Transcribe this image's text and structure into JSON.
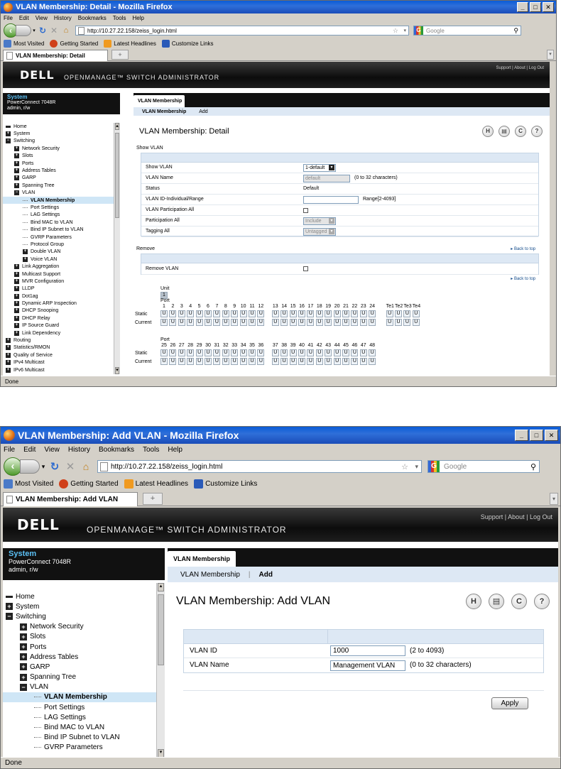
{
  "w1": {
    "title": "VLAN Membership: Detail - Mozilla Firefox",
    "menu": [
      "File",
      "Edit",
      "View",
      "History",
      "Bookmarks",
      "Tools",
      "Help"
    ],
    "url": "http://10.27.22.158/zeiss_login.html",
    "search_placeholder": "Google",
    "bookmarks": [
      "Most Visited",
      "Getting Started",
      "Latest Headlines",
      "Customize Links"
    ],
    "tab": "VLAN Membership: Detail",
    "brand": "DELL",
    "product": "OPENMANAGE™ SWITCH ADMINISTRATOR",
    "toplinks": "Support | About | Log Out",
    "system": {
      "title": "System",
      "model": "PowerConnect 7048R",
      "user": "admin, r/w"
    },
    "tree": [
      {
        "label": "Home",
        "lvl": 0,
        "exp": "dash"
      },
      {
        "label": "System",
        "lvl": 0,
        "exp": "plus"
      },
      {
        "label": "Switching",
        "lvl": 0,
        "exp": "minus"
      },
      {
        "label": "Network Security",
        "lvl": 1,
        "exp": "plus"
      },
      {
        "label": "Slots",
        "lvl": 1,
        "exp": "plus"
      },
      {
        "label": "Ports",
        "lvl": 1,
        "exp": "plus"
      },
      {
        "label": "Address Tables",
        "lvl": 1,
        "exp": "plus"
      },
      {
        "label": "GARP",
        "lvl": 1,
        "exp": "plus"
      },
      {
        "label": "Spanning Tree",
        "lvl": 1,
        "exp": "plus"
      },
      {
        "label": "VLAN",
        "lvl": 1,
        "exp": "minus"
      },
      {
        "label": "VLAN Membership",
        "lvl": 2,
        "exp": "none",
        "sel": true
      },
      {
        "label": "Port Settings",
        "lvl": 2,
        "exp": "none"
      },
      {
        "label": "LAG Settings",
        "lvl": 2,
        "exp": "none"
      },
      {
        "label": "Bind MAC to VLAN",
        "lvl": 2,
        "exp": "none"
      },
      {
        "label": "Bind IP Subnet to VLAN",
        "lvl": 2,
        "exp": "none"
      },
      {
        "label": "GVRP Parameters",
        "lvl": 2,
        "exp": "none"
      },
      {
        "label": "Protocol Group",
        "lvl": 2,
        "exp": "none"
      },
      {
        "label": "Double VLAN",
        "lvl": 2,
        "exp": "plus"
      },
      {
        "label": "Voice VLAN",
        "lvl": 2,
        "exp": "plus"
      },
      {
        "label": "Link Aggregation",
        "lvl": 1,
        "exp": "plus"
      },
      {
        "label": "Multicast Support",
        "lvl": 1,
        "exp": "plus"
      },
      {
        "label": "MVR Configuration",
        "lvl": 1,
        "exp": "plus"
      },
      {
        "label": "LLDP",
        "lvl": 1,
        "exp": "plus"
      },
      {
        "label": "Dot1ag",
        "lvl": 1,
        "exp": "plus"
      },
      {
        "label": "Dynamic ARP Inspection",
        "lvl": 1,
        "exp": "plus"
      },
      {
        "label": "DHCP Snooping",
        "lvl": 1,
        "exp": "plus"
      },
      {
        "label": "DHCP Relay",
        "lvl": 1,
        "exp": "plus"
      },
      {
        "label": "IP Source Guard",
        "lvl": 1,
        "exp": "plus"
      },
      {
        "label": "Link Dependency",
        "lvl": 1,
        "exp": "plus"
      },
      {
        "label": "Routing",
        "lvl": 0,
        "exp": "plus"
      },
      {
        "label": "Statistics/RMON",
        "lvl": 0,
        "exp": "plus"
      },
      {
        "label": "Quality of Service",
        "lvl": 0,
        "exp": "plus"
      },
      {
        "label": "IPv4 Multicast",
        "lvl": 0,
        "exp": "plus"
      },
      {
        "label": "IPv6 Multicast",
        "lvl": 0,
        "exp": "plus"
      }
    ],
    "section_tab": "VLAN Membership",
    "subnav": [
      "VLAN Membership",
      "Add"
    ],
    "page_title": "VLAN Membership: Detail",
    "show_vlan_heading": "Show VLAN",
    "fields": [
      {
        "label": "Show VLAN",
        "type": "select",
        "value": "1-default"
      },
      {
        "label": "VLAN Name",
        "type": "disabled",
        "value": "default",
        "note": "(0 to 32 characters)"
      },
      {
        "label": "Status",
        "type": "text",
        "value": "Default"
      },
      {
        "label": "VLAN ID-Individual/Range",
        "type": "input",
        "value": "",
        "note": "Range[2-4093]"
      },
      {
        "label": "VLAN Participation All",
        "type": "check"
      },
      {
        "label": "Participation All",
        "type": "select-dis",
        "value": "Include"
      },
      {
        "label": "Tagging All",
        "type": "select-dis",
        "value": "Untagged"
      }
    ],
    "remove_heading": "Remove",
    "back_to_top": "Back to top",
    "remove_label": "Remove VLAN",
    "unit_label": "Unit",
    "unit_value": "1",
    "port_label": "Port",
    "static_label": "Static",
    "current_label": "Current",
    "port_cell": "U",
    "port_row1": [
      "1",
      "2",
      "3",
      "4",
      "5",
      "6",
      "7",
      "8",
      "9",
      "10",
      "11",
      "12",
      "13",
      "14",
      "15",
      "16",
      "17",
      "18",
      "19",
      "20",
      "21",
      "22",
      "23",
      "24",
      "Te1",
      "Te2",
      "Te3",
      "Te4"
    ],
    "port_row2": [
      "25",
      "26",
      "27",
      "28",
      "29",
      "30",
      "31",
      "32",
      "33",
      "34",
      "35",
      "36",
      "37",
      "38",
      "39",
      "40",
      "41",
      "42",
      "43",
      "44",
      "45",
      "46",
      "47",
      "48"
    ],
    "status": "Done"
  },
  "w2": {
    "title": "VLAN Membership: Add VLAN - Mozilla Firefox",
    "menu": [
      "File",
      "Edit",
      "View",
      "History",
      "Bookmarks",
      "Tools",
      "Help"
    ],
    "url": "http://10.27.22.158/zeiss_login.html",
    "search_placeholder": "Google",
    "bookmarks": [
      "Most Visited",
      "Getting Started",
      "Latest Headlines",
      "Customize Links"
    ],
    "tab": "VLAN Membership: Add VLAN",
    "brand": "DELL",
    "product": "OPENMANAGE™ SWITCH ADMINISTRATOR",
    "toplinks": "Support | About | Log Out",
    "system": {
      "title": "System",
      "model": "PowerConnect 7048R",
      "user": "admin, r/w"
    },
    "tree": [
      {
        "label": "Home",
        "lvl": 0,
        "exp": "dash"
      },
      {
        "label": "System",
        "lvl": 0,
        "exp": "plus"
      },
      {
        "label": "Switching",
        "lvl": 0,
        "exp": "minus"
      },
      {
        "label": "Network Security",
        "lvl": 1,
        "exp": "plus"
      },
      {
        "label": "Slots",
        "lvl": 1,
        "exp": "plus"
      },
      {
        "label": "Ports",
        "lvl": 1,
        "exp": "plus"
      },
      {
        "label": "Address Tables",
        "lvl": 1,
        "exp": "plus"
      },
      {
        "label": "GARP",
        "lvl": 1,
        "exp": "plus"
      },
      {
        "label": "Spanning Tree",
        "lvl": 1,
        "exp": "plus"
      },
      {
        "label": "VLAN",
        "lvl": 1,
        "exp": "minus"
      },
      {
        "label": "VLAN Membership",
        "lvl": 2,
        "exp": "none",
        "sel": true
      },
      {
        "label": "Port Settings",
        "lvl": 2,
        "exp": "none"
      },
      {
        "label": "LAG Settings",
        "lvl": 2,
        "exp": "none"
      },
      {
        "label": "Bind MAC to VLAN",
        "lvl": 2,
        "exp": "none"
      },
      {
        "label": "Bind IP Subnet to VLAN",
        "lvl": 2,
        "exp": "none"
      },
      {
        "label": "GVRP Parameters",
        "lvl": 2,
        "exp": "none"
      }
    ],
    "section_tab": "VLAN Membership",
    "subnav": [
      "VLAN Membership",
      "Add"
    ],
    "page_title": "VLAN Membership: Add VLAN",
    "fields": [
      {
        "label": "VLAN ID",
        "value": "1000",
        "note": "(2 to 4093)"
      },
      {
        "label": "VLAN Name",
        "value": "Management VLAN",
        "note": "(0 to 32 characters)"
      }
    ],
    "apply": "Apply",
    "status": "Done"
  }
}
